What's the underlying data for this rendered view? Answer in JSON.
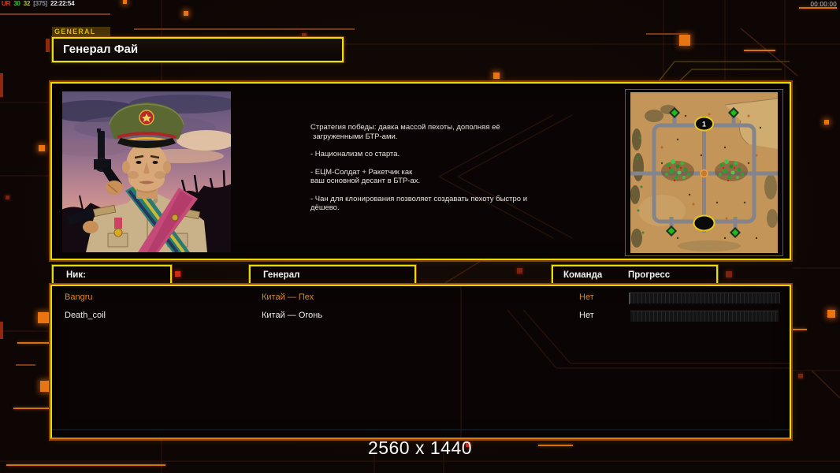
{
  "debug_overlay": {
    "tokens": [
      "UR",
      "30",
      "32",
      "[375]",
      "22:22:54"
    ]
  },
  "clock": "00:00:00",
  "tab": {
    "label": "GENERAL"
  },
  "general": {
    "title": "Генерал Фай",
    "strategy_lines": [
      "Стратегия победы: давка массой пехоты, дополняя её",
      "загруженными БТР-ами.",
      "- Национализм со старта.",
      "- ЕЦМ-Солдат + Ракетчик как",
      "ваш основной десант в БТР-ах.",
      "- Чан для клонирования позволяет создавать пехоту быстро и",
      "дёшево."
    ]
  },
  "minimap": {
    "start_marker": "1"
  },
  "table": {
    "headers": {
      "nick": "Ник:",
      "general": "Генерал",
      "team": "Команда",
      "progress": "Прогресс"
    }
  },
  "players": [
    {
      "name": "Bangru",
      "general": "Китай — Пех",
      "team": "Нет",
      "progress_percent": 0,
      "row_color": "#d8891f"
    },
    {
      "name": "Death_coil",
      "general": "Китай — Огонь",
      "team": "Нет",
      "progress_percent": 0,
      "row_color": "#ebebeb"
    }
  ],
  "footer": {
    "resolution_label": "2560 x 1440"
  },
  "colors": {
    "accent_yellow": "#e8dc00",
    "accent_orange": "#e07d00",
    "tab_text": "#dcb903",
    "highlight_row": "#d8891f"
  }
}
